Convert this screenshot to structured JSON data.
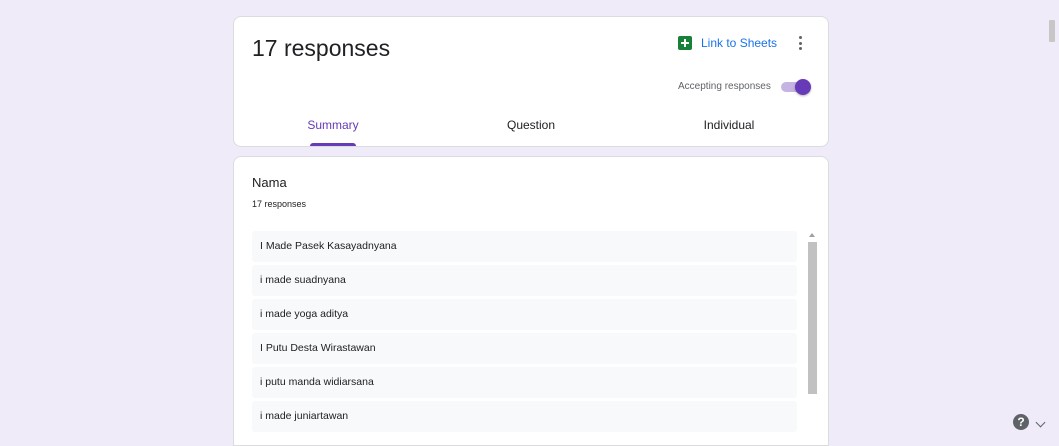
{
  "header": {
    "responses_title": "17 responses",
    "link_sheets_label": "Link to Sheets",
    "accepting_label": "Accepting responses",
    "accepting_on": true
  },
  "tabs": [
    {
      "label": "Summary",
      "active": true
    },
    {
      "label": "Question",
      "active": false
    },
    {
      "label": "Individual",
      "active": false
    }
  ],
  "question": {
    "title": "Nama",
    "count": "17 responses",
    "answers": [
      "I Made Pasek Kasayadnyana",
      "i made suadnyana",
      "i made yoga aditya",
      "I Putu Desta Wirastawan",
      "i putu manda widiarsana",
      "i made juniartawan"
    ]
  },
  "help_icon_label": "?",
  "colors": {
    "background": "#f0ebf8",
    "accent": "#673ab7",
    "link": "#1a73e8",
    "sheets": "#188038"
  }
}
